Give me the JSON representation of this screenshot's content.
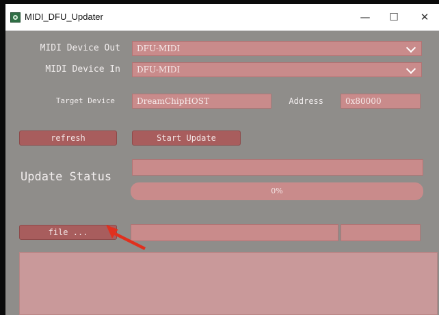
{
  "window": {
    "title": "MIDI_DFU_Updater",
    "controls": {
      "minimize": "—",
      "maximize": "☐",
      "close": "✕"
    }
  },
  "midi_out": {
    "label": "MIDI Device Out",
    "value": "DFU-MIDI"
  },
  "midi_in": {
    "label": "MIDI Device In",
    "value": "DFU-MIDI"
  },
  "target": {
    "label": "Target Device",
    "value": "DreamChipHOST"
  },
  "address": {
    "label": "Address",
    "value": "0x80000"
  },
  "buttons": {
    "refresh": "refresh",
    "start_update": "Start Update",
    "file": "file ..."
  },
  "status": {
    "label": "Update Status",
    "progress_text": "0%",
    "progress": 0
  },
  "colors": {
    "panel": "#8f8d8a",
    "field": "#c98b8b",
    "button": "#a85d5d",
    "arrow": "#e0301e"
  }
}
